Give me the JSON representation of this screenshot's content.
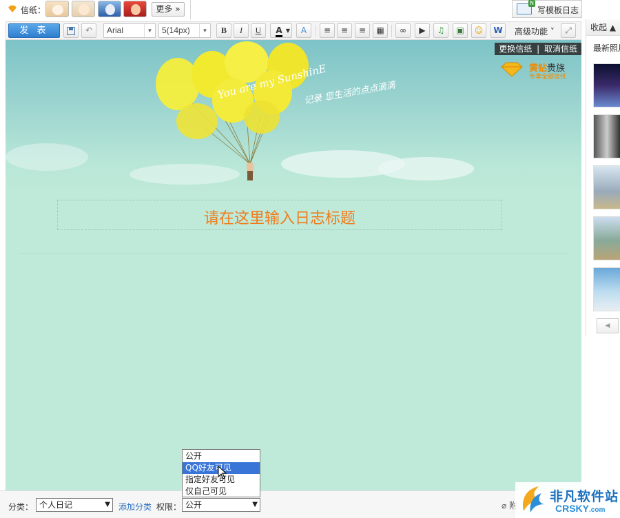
{
  "stationery": {
    "label": "信纸：",
    "more_label": "更多 »",
    "thumbnails": [
      "stationery-thumb-1",
      "stationery-thumb-2",
      "stationery-thumb-3",
      "stationery-thumb-4"
    ]
  },
  "template_button": {
    "label": "写模板日志"
  },
  "toolbar": {
    "publish_label": "发 表",
    "font_family": "Arial",
    "font_size": "5(14px)",
    "bold": "B",
    "italic": "I",
    "underline": "U",
    "font_color": "A",
    "advanced_label": "高级功能 ˅",
    "icons": [
      "save-icon",
      "undo-icon",
      "align-left-icon",
      "align-center-icon",
      "align-right-icon",
      "table-icon",
      "link-icon",
      "video-icon",
      "music-icon",
      "image-icon",
      "emoji-icon",
      "word-icon",
      "fullscreen-icon"
    ]
  },
  "sidebar": {
    "collapse_label": "收起 ▲",
    "latest_label": "最新照片",
    "prev_label": "◀"
  },
  "editor": {
    "change_stationery": "更换信纸",
    "separator": "|",
    "cancel_stationery": "取消信纸",
    "hero_text_script": "You are my SunshinE",
    "hero_text_cn": "记录 您生活的点点滴滴",
    "vip_title": "黄钻",
    "vip_title_suffix": "贵族",
    "vip_sub": "专享全部信纸",
    "title_placeholder": "请在这里输入日志标题",
    "balloon_color": "#f4ee3c"
  },
  "bottom": {
    "category_label": "分类：",
    "category_value": "个人日记",
    "add_category": "添加分类",
    "permission_label": "权限：",
    "permission_value": "公开",
    "attach_label": "附"
  },
  "permission_dropdown": {
    "options": [
      "公开",
      "QQ好友可见",
      "指定好友可见",
      "仅自己可见"
    ],
    "highlighted": 1
  },
  "watermark": {
    "cn": "非凡软件站",
    "en": "CRSKY",
    "en_suffix": ".com"
  }
}
